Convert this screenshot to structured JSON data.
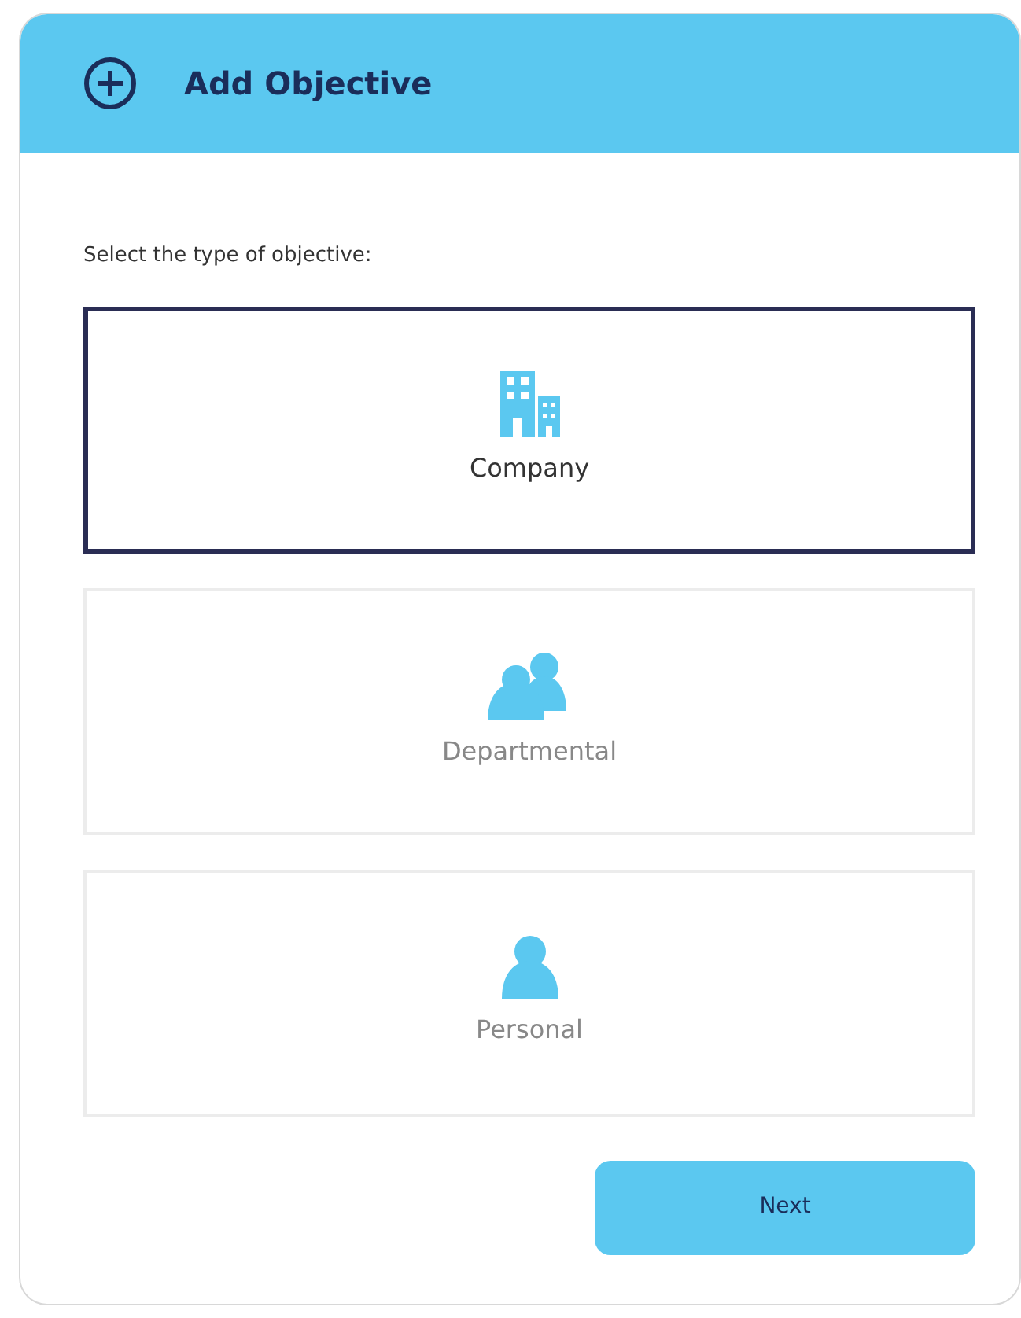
{
  "dialog": {
    "title": "Add Objective"
  },
  "prompt": "Select the type of objective:",
  "options": [
    {
      "label": "Company",
      "kind": "building",
      "selected": true
    },
    {
      "label": "Departmental",
      "kind": "group",
      "selected": false
    },
    {
      "label": "Personal",
      "kind": "person",
      "selected": false
    }
  ],
  "buttons": [
    "Next"
  ]
}
